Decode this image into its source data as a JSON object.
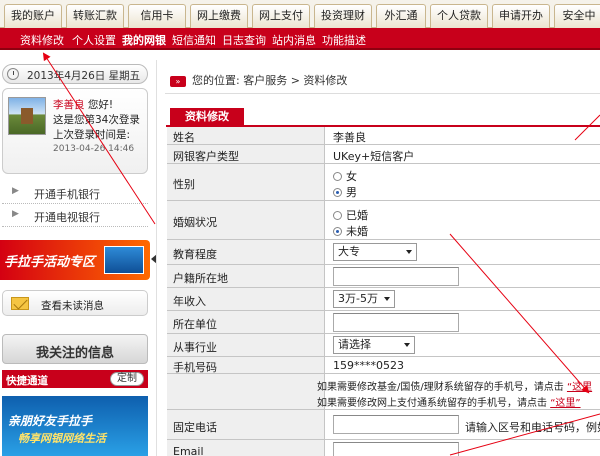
{
  "topnav": {
    "tabs": [
      "我的账户",
      "转账汇款",
      "信用卡",
      "网上缴费",
      "网上支付",
      "投资理财",
      "外汇通",
      "个人贷款",
      "申请开办",
      "安全中"
    ]
  },
  "subnav": {
    "items": [
      "资料修改",
      "个人设置",
      "我的网银",
      "短信通知",
      "日志查询",
      "站内消息",
      "功能描述"
    ],
    "active_index": 2
  },
  "sidebar": {
    "date": "2013年4月26日 星期五",
    "user_name": "李善良",
    "greeting": "您好!",
    "login_count_line": "这是您第34次登录",
    "last_login_label": "上次登录时间是:",
    "last_login_time": "2013-04-26 14:46",
    "links": [
      "开通手机银行",
      "开通电视银行"
    ],
    "promo_label": "手拉手活动专区",
    "unread_label": "查看未读消息",
    "follow_title": "我关注的信息",
    "quick_title": "快捷通道",
    "quick_btn": "定制",
    "banner_line1": "亲朋好友手拉手",
    "banner_line2": "畅享网银网络生活"
  },
  "breadcrumb": {
    "prefix": "您的位置:",
    "path": "客户服务 > 资料修改"
  },
  "form": {
    "tab_title": "资料修改",
    "name_label": "姓名",
    "name_value": "李善良",
    "type_label": "网银客户类型",
    "type_value": "UKey+短信客户",
    "gender_label": "性别",
    "gender_options": [
      "女",
      "男"
    ],
    "gender_selected": "男",
    "marital_label": "婚姻状况",
    "marital_options": [
      "已婚",
      "未婚"
    ],
    "marital_selected": "未婚",
    "edu_label": "教育程度",
    "edu_value": "大专",
    "hukou_label": "户籍所在地",
    "hukou_value": "",
    "income_label": "年收入",
    "income_value": "3万-5万",
    "employer_label": "所在单位",
    "employer_value": "",
    "industry_label": "从事行业",
    "industry_value": "请选择",
    "mobile_label": "手机号码",
    "mobile_value": "159****0523",
    "note1_text": "如果需要修改基金/国债/理财系统留存的手机号，请点击",
    "note1_link": "“这里",
    "note2_text": "如果需要修改网上支付通系统留存的手机号，请点击",
    "note2_link": "“这里”",
    "phone_label": "固定电话",
    "phone_hint": "请输入区号和电话号码，例如:",
    "email_label": "Email"
  },
  "colors": {
    "brand_red": "#c8001b",
    "label_bg": "#efefef"
  }
}
